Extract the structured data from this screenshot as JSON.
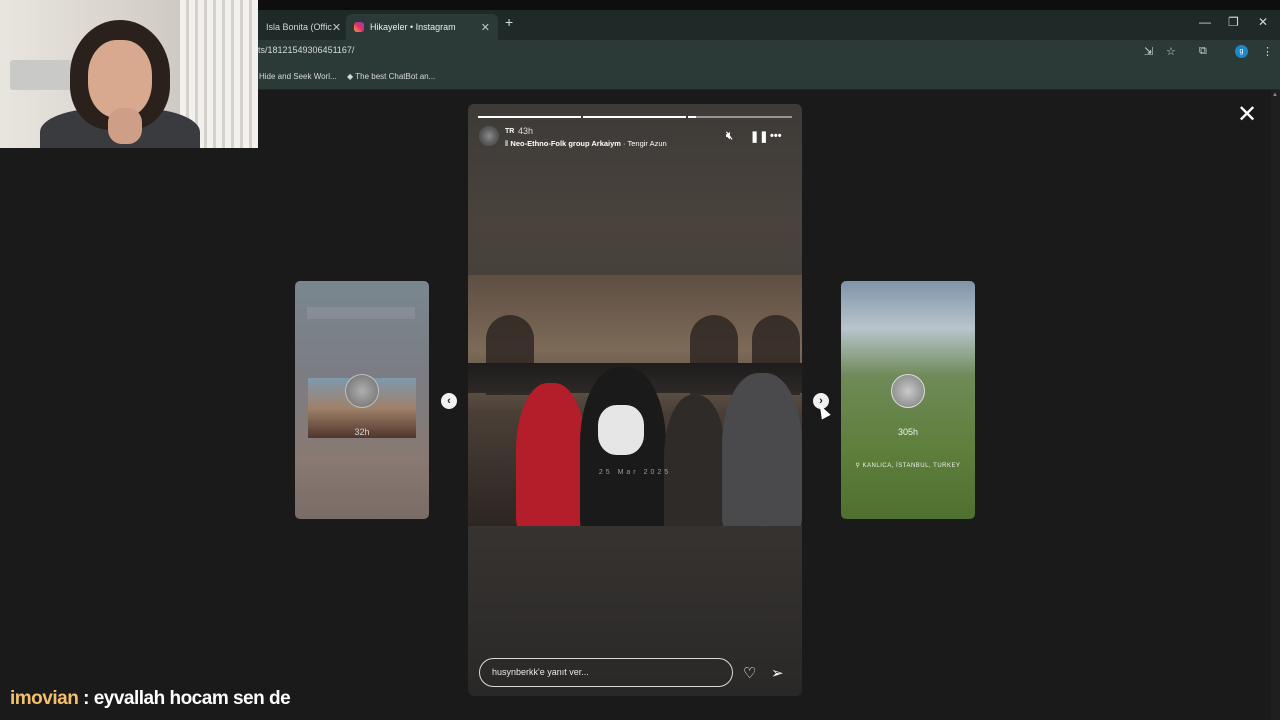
{
  "browser": {
    "tabs": [
      {
        "title": "Isla Bonita (Offic",
        "active": false
      },
      {
        "title": "Hikayeler • Instagram",
        "active": true
      }
    ],
    "url": "ts/18121549306451167/",
    "bookmarks": [
      "Hide and Seek Worl...",
      "The best ChatBot an..."
    ],
    "profile_initial": "g"
  },
  "story": {
    "username": "TR",
    "time_ago": "43h",
    "music_prefix": "Neo-Ethno-Folk group Arkaiym",
    "music_track": "Tengir Azun",
    "photo_stamp": "25 Mar 2025",
    "reply_placeholder": "husynberkk'e yanıt ver...",
    "progress_segments": 3,
    "progress_current": 3,
    "prev_story_time": "32h",
    "next_story_time": "305h",
    "next_story_location": "KANLICA, İSTANBUL, TURKEY"
  },
  "icons": {
    "close": "close-icon",
    "mute": "speaker-muted-icon",
    "pause": "pause-icon",
    "more": "more-horizontal-icon",
    "heart": "heart-icon",
    "send": "send-icon",
    "prev": "chevron-left-icon",
    "next": "chevron-right-icon"
  },
  "chat_overlay": {
    "user": "imovian",
    "message": " : eyvallah hocam sen de"
  },
  "colors": {
    "chat_user": "#f4c06a",
    "tab_bar": "#1f2a28",
    "toolbar": "#2c3a37"
  }
}
